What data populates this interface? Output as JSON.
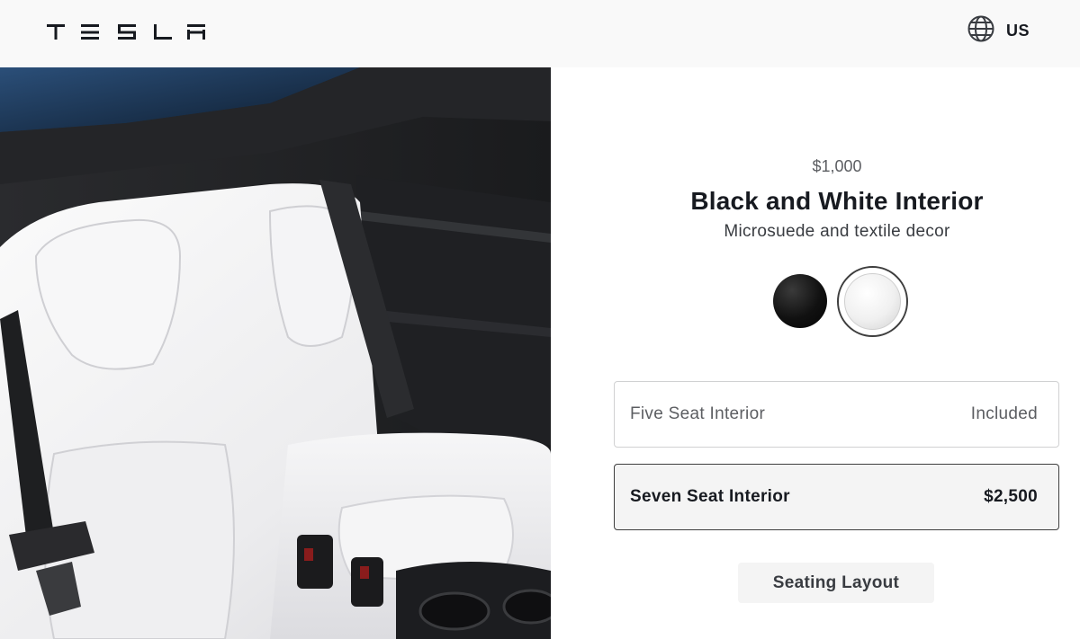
{
  "header": {
    "brand": "TESLA",
    "locale_label": "US",
    "locale_icon": "globe-icon"
  },
  "hero": {
    "image": "rear-seats-interior-photo"
  },
  "config": {
    "price": "$1,000",
    "title": "Black and White Interior",
    "subtitle": "Microsuede and textile decor",
    "swatches": [
      {
        "name": "black",
        "color": "#111111",
        "selected": false
      },
      {
        "name": "white",
        "color": "#f2f2f2",
        "selected": true
      }
    ],
    "options": [
      {
        "label": "Five Seat Interior",
        "price": "Included",
        "selected": false
      },
      {
        "label": "Seven Seat Interior",
        "price": "$2,500",
        "selected": true
      }
    ],
    "layout_button": "Seating Layout"
  }
}
